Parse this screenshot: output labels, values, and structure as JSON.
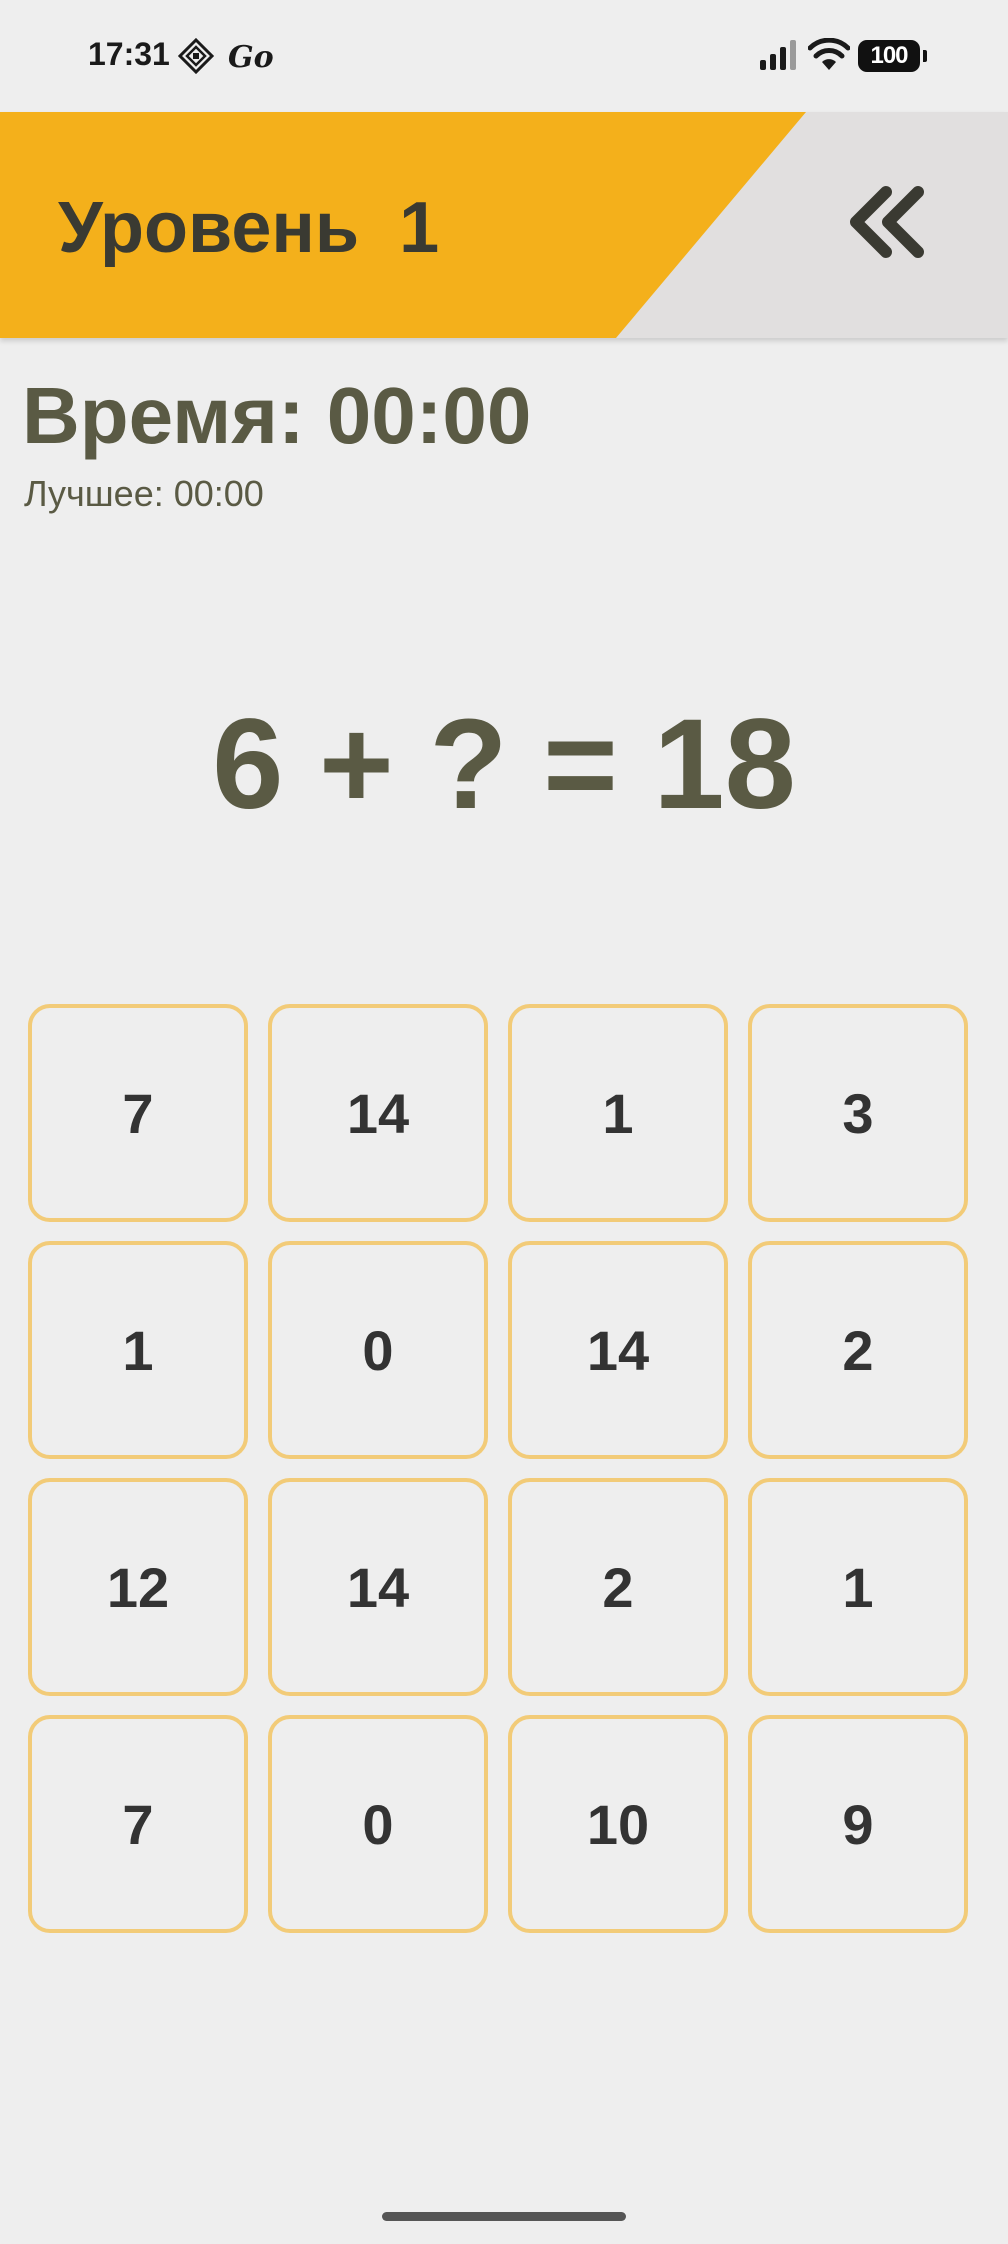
{
  "status_bar": {
    "time": "17:31",
    "icons": [
      "grid-diamond-icon",
      "go-icon",
      "signal-icon",
      "wifi-icon",
      "battery-icon"
    ],
    "go_text": "Go",
    "battery": "100"
  },
  "header": {
    "title": "Уровень  1",
    "back_icon": "double-chevron-left-icon",
    "colors": {
      "accent": "#f4b01b",
      "background": "#e1dfdf",
      "text": "#3a3a32"
    }
  },
  "timer": {
    "time_text": "Время: 00:00",
    "best_text": "Лучшее: 00:00"
  },
  "equation": {
    "text": "6 + ? = 18"
  },
  "answers": [
    "7",
    "14",
    "1",
    "3",
    "1",
    "0",
    "14",
    "2",
    "12",
    "14",
    "2",
    "1",
    "7",
    "0",
    "10",
    "9"
  ],
  "colors": {
    "page_background": "#eeeeee",
    "cell_border": "#f2cb78",
    "text_dark": "#5a5a44"
  }
}
